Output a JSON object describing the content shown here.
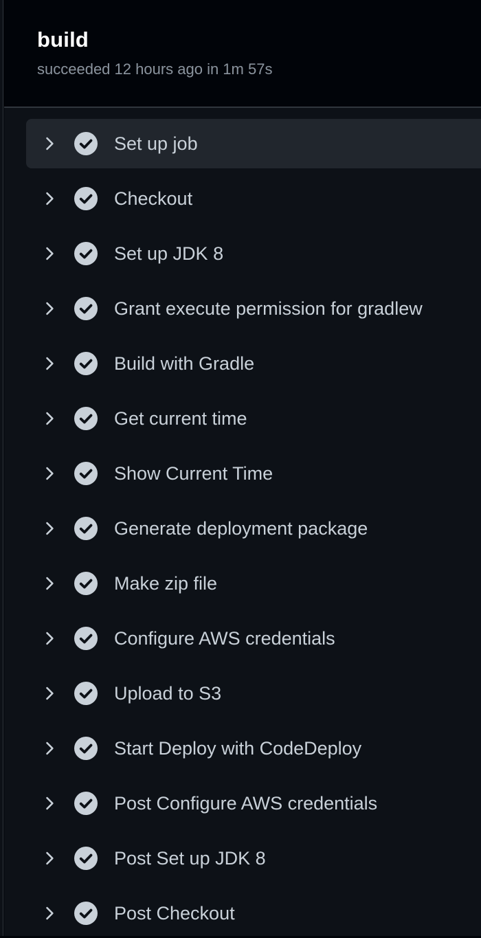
{
  "job": {
    "title": "build",
    "status": "succeeded 12 hours ago in 1m 57s"
  },
  "icons": {
    "chevron": "chevron-right-icon",
    "check": "check-circle-fill-icon"
  },
  "colors": {
    "background": "#010409",
    "steps_background": "#0d1117",
    "active_row": "#21262d",
    "text": "#c9d1d9",
    "muted_text": "#8b949e",
    "check_icon": "#c9d1d9"
  },
  "steps": [
    {
      "label": "Set up job",
      "active": true
    },
    {
      "label": "Checkout",
      "active": false
    },
    {
      "label": "Set up JDK 8",
      "active": false
    },
    {
      "label": "Grant execute permission for gradlew",
      "active": false
    },
    {
      "label": "Build with Gradle",
      "active": false
    },
    {
      "label": "Get current time",
      "active": false
    },
    {
      "label": "Show Current Time",
      "active": false
    },
    {
      "label": "Generate deployment package",
      "active": false
    },
    {
      "label": "Make zip file",
      "active": false
    },
    {
      "label": "Configure AWS credentials",
      "active": false
    },
    {
      "label": "Upload to S3",
      "active": false
    },
    {
      "label": "Start Deploy with CodeDeploy",
      "active": false
    },
    {
      "label": "Post Configure AWS credentials",
      "active": false
    },
    {
      "label": "Post Set up JDK 8",
      "active": false
    },
    {
      "label": "Post Checkout",
      "active": false
    }
  ]
}
